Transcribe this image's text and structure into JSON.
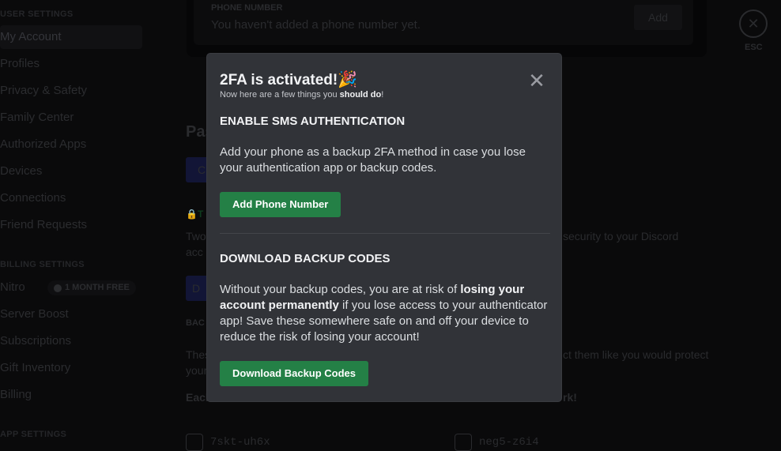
{
  "sidebar": {
    "user_settings": "USER SETTINGS",
    "items": [
      "My Account",
      "Profiles",
      "Privacy & Safety",
      "Family Center",
      "Authorized Apps",
      "Devices",
      "Connections",
      "Friend Requests"
    ],
    "billing_settings": "BILLING SETTINGS",
    "billing_items": [
      "Nitro",
      "Server Boost",
      "Subscriptions",
      "Gift Inventory",
      "Billing"
    ],
    "nitro_badge": "1 MONTH FREE",
    "app_settings": "APP SETTINGS"
  },
  "background": {
    "phone_label": "PHONE NUMBER",
    "phone_text": "You haven't added a phone number yet.",
    "add_button": "Add",
    "esc_label": "ESC",
    "password_heading_fragment": "Pas",
    "btn1_fragment": "C",
    "twofa_fragment": "T",
    "two_left": "Two",
    "two_right": "security to your Discord",
    "acc_fragment": "acc",
    "btn2_fragment": "D",
    "backup_fragment": "BAC",
    "these_left": "Thes",
    "these_right": "ct them like you would protect",
    "your_fragment": "your",
    "each_left": "Each",
    "each_right": "rk!",
    "codes": [
      "7skt-uh6x",
      "neg5-z6i4"
    ]
  },
  "modal": {
    "title": "2FA is activated!",
    "emoji": "🎉",
    "subtitle_pre": "Now here are a few things you ",
    "subtitle_bold": "should do",
    "subtitle_post": "!",
    "sms_heading": "ENABLE SMS AUTHENTICATION",
    "sms_text": "Add your phone as a backup 2FA method in case you lose your authentication app or backup codes.",
    "add_phone_button": "Add Phone Number",
    "backup_heading": "DOWNLOAD BACKUP CODES",
    "backup_pre": "Without your backup codes, you are at risk of ",
    "backup_bold": "losing your account permanently",
    "backup_post": " if you lose access to your authenticator app! Save these somewhere safe on and off your device to reduce the risk of losing your account!",
    "download_button": "Download Backup Codes"
  },
  "colors": {
    "accent_green": "#248046",
    "modal_bg": "#313338"
  }
}
